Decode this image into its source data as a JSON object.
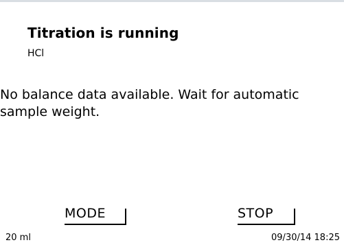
{
  "header": {
    "title": "Titration is running",
    "subtitle": "HCl"
  },
  "message": "No balance data available. Wait for automatic sample weight.",
  "softkeys": {
    "mode": "MODE",
    "stop": "STOP"
  },
  "status": {
    "volume": "20 ml",
    "datetime": "09/30/14 18:25"
  },
  "colors": {
    "background": "#ffffff",
    "text": "#000000",
    "top_rule": "#d9dee3"
  }
}
